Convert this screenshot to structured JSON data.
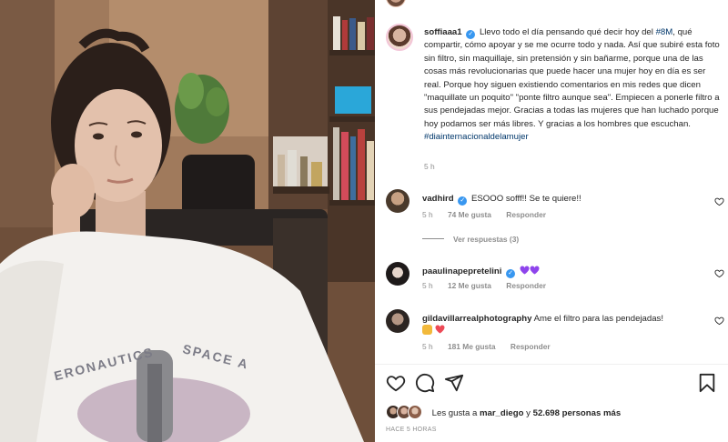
{
  "post": {
    "author": "soffiaaa1",
    "caption_parts": [
      "Llevo todo el día pensando qué decir hoy del ",
      "#8M",
      ", qué compartir, cómo apoyar y se me ocurre todo y nada. Así que subiré esta foto sin filtro, sin maquillaje, sin pretensión y sin bañarme, porque una de las cosas más revolucionarias que puede hacer una mujer hoy en día es ser real. Porque hoy siguen existiendo comentarios en mis redes que dicen \"maquillate un poquito\" \"ponte filtro aunque sea\". Empiecen a ponerle filtro a sus pendejadas mejor. Gracias a todas las mujeres que han luchado porque hoy podamos ser más libres. Y gracias a los hombres que escuchan. ",
      "#diainternacionaldelamujer"
    ],
    "caption_time": "5 h",
    "photo_print_left": "ERONAUTICS",
    "photo_print_right": "SPACE A"
  },
  "comments": [
    {
      "username": "vadhird",
      "text": "ESOOO sofff!! Se te quiere!!",
      "time": "5 h",
      "likes": "74 Me gusta",
      "reply": "Responder"
    },
    {
      "username": "paaulinapepretelini",
      "text": "",
      "time": "5 h",
      "likes": "12 Me gusta",
      "reply": "Responder"
    },
    {
      "username": "gildavillarrealphotography",
      "text": "Ame el filtro para las pendejadas!",
      "time": "5 h",
      "likes": "181 Me gusta",
      "reply": "Responder"
    }
  ],
  "view_replies": "Ver respuestas (3)",
  "likes_summary": {
    "prefix": "Les gusta a ",
    "user": "mar_diego",
    "middle": " y ",
    "count": "52.698 personas más"
  },
  "post_date": "HACE 5 HORAS",
  "icons": {
    "verified": "verified-badge-icon",
    "like": "heart-icon",
    "comment": "comment-icon",
    "share": "share-icon",
    "save": "bookmark-icon"
  },
  "colors": {
    "verified": "#3897f0",
    "hashtag": "#00376b",
    "muted": "#8e8e8e",
    "purple_heart": "#8e44ec",
    "red_heart": "#ed4956"
  }
}
